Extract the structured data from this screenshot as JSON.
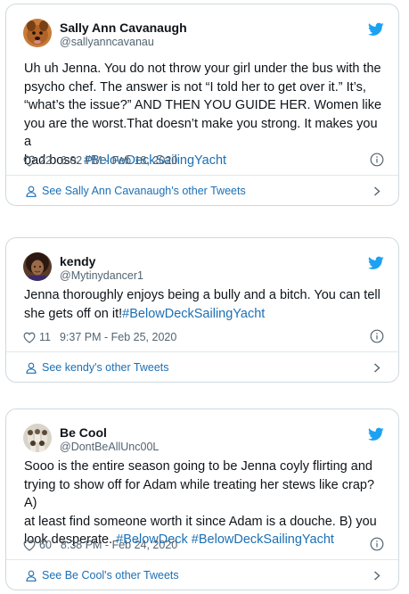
{
  "tweets": [
    {
      "name": "Sally Ann Cavanaugh",
      "handle": "@sallyanncavanau",
      "text": "Uh uh Jenna. You do not throw your girl under the bus with the\npsycho chef. The answer is not “I told her to get over it.” It’s,\n“what’s the issue?” AND THEN YOU GUIDE HER. Women like\nyou are the worst.That doesn’t make you strong. It makes you a\nbad boss. ",
      "hashtags": "#BelowDeckSailingYacht",
      "likes": "22",
      "timestamp": "6:02 PM - Feb 18, 2020",
      "footer": "See Sally Ann Cavanaugh's other Tweets",
      "avatar_icon": "dog-avatar"
    },
    {
      "name": "kendy",
      "handle": "@Mytinydancer1",
      "text": "Jenna thoroughly enjoys being a bully and a bitch. You can tell\nshe gets off on it!",
      "hashtags": "#BelowDeckSailingYacht",
      "likes": "11",
      "timestamp": "9:37 PM - Feb 25, 2020",
      "footer": "See kendy's other Tweets",
      "avatar_icon": "person-avatar"
    },
    {
      "name": "Be Cool",
      "handle": "@DontBeAllUnc00L",
      "text": "Sooo is the entire season going to be Jenna coyly flirting and\ntrying to show off for Adam while treating her stews like crap? A)\nat least find someone worth it since Adam is a douche. B) you\nlook desperate. ",
      "hashtags": "#BelowDeck #BelowDeckSailingYacht",
      "likes": "60",
      "timestamp": "8:38 PM - Feb 24, 2020",
      "footer": "See Be Cool's other Tweets",
      "avatar_icon": "group-avatar"
    }
  ],
  "colors": {
    "accent": "#1da1f2",
    "link": "#1b6fb5",
    "border": "#cfd9de",
    "muted": "#536471"
  }
}
